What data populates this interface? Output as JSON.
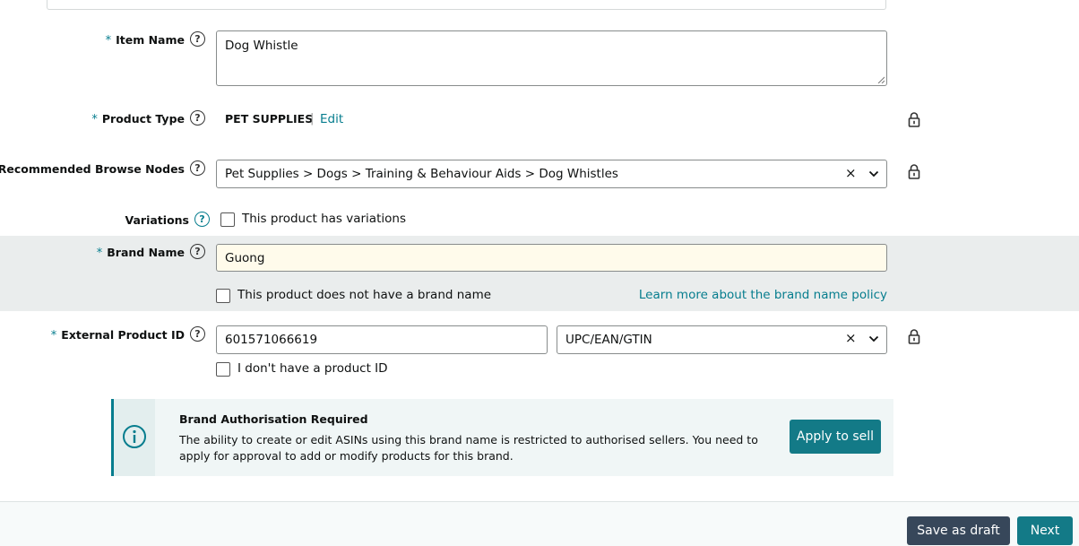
{
  "item_name": {
    "label": "Item Name",
    "value": "Dog Whistle"
  },
  "product_type": {
    "label": "Product Type",
    "value": "PET SUPPLIES",
    "separator": "|",
    "edit_label": "Edit"
  },
  "browse_nodes": {
    "label": "Recommended Browse Nodes",
    "value": "Pet Supplies > Dogs > Training & Behaviour Aids > Dog Whistles",
    "clear_icon": "×"
  },
  "variations": {
    "label": "Variations",
    "checkbox_label": "This product has variations"
  },
  "brand_name": {
    "label": "Brand Name",
    "value": "Guong",
    "no_brand_label": "This product does not have a brand name",
    "policy_link": "Learn more about the brand name policy",
    "highlight_color": "#fffbeb"
  },
  "external_id": {
    "label": "External Product ID",
    "value": "601571066619",
    "type_value": "UPC/EAN/GTIN",
    "clear_icon": "×",
    "no_id_label": "I don't have a product ID"
  },
  "alert": {
    "title": "Brand Authorisation Required",
    "body": "The ability to create or edit ASINs using this brand name is restricted to authorised sellers. You need to apply for approval to add or modify products for this brand.",
    "button_label": "Apply to sell",
    "icon": "info-icon"
  },
  "footer": {
    "save_draft_label": "Save as draft",
    "next_label": "Next"
  },
  "common": {
    "required_mark": "*",
    "help_glyph": "?"
  },
  "colors": {
    "accent": "#067d8e",
    "button_teal": "#137a87",
    "button_dark": "#37475a",
    "band": "#eaeded"
  }
}
